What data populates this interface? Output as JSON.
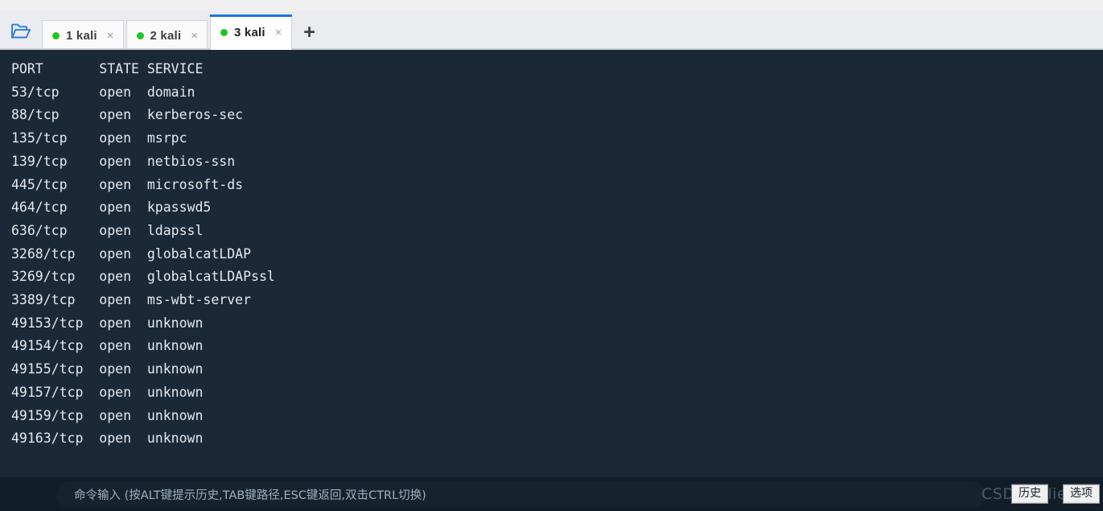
{
  "toolbar": {
    "folder_icon": "open-folder-icon",
    "new_tab_label": "+",
    "tabs": [
      {
        "index": "1",
        "label": "1 kali",
        "status": "connected",
        "close": "×"
      },
      {
        "index": "2",
        "label": "2 kali",
        "status": "connected",
        "close": "×"
      },
      {
        "index": "3",
        "label": "3 kali",
        "status": "connected",
        "close": "×"
      }
    ],
    "active_tab_index": 2
  },
  "terminal": {
    "header": "PORT       STATE SERVICE",
    "lines": [
      "PORT       STATE SERVICE",
      "53/tcp     open  domain",
      "88/tcp     open  kerberos-sec",
      "135/tcp    open  msrpc",
      "139/tcp    open  netbios-ssn",
      "445/tcp    open  microsoft-ds",
      "464/tcp    open  kpasswd5",
      "636/tcp    open  ldapssl",
      "3268/tcp   open  globalcatLDAP",
      "3269/tcp   open  globalcatLDAPssl",
      "3389/tcp   open  ms-wbt-server",
      "49153/tcp  open  unknown",
      "49154/tcp  open  unknown",
      "49155/tcp  open  unknown",
      "49157/tcp  open  unknown",
      "49159/tcp  open  unknown",
      "49163/tcp  open  unknown"
    ],
    "rows": [
      {
        "port": "53/tcp",
        "state": "open",
        "service": "domain"
      },
      {
        "port": "88/tcp",
        "state": "open",
        "service": "kerberos-sec"
      },
      {
        "port": "135/tcp",
        "state": "open",
        "service": "msrpc"
      },
      {
        "port": "139/tcp",
        "state": "open",
        "service": "netbios-ssn"
      },
      {
        "port": "445/tcp",
        "state": "open",
        "service": "microsoft-ds"
      },
      {
        "port": "464/tcp",
        "state": "open",
        "service": "kpasswd5"
      },
      {
        "port": "636/tcp",
        "state": "open",
        "service": "ldapssl"
      },
      {
        "port": "3268/tcp",
        "state": "open",
        "service": "globalcatLDAP"
      },
      {
        "port": "3269/tcp",
        "state": "open",
        "service": "globalcatLDAPssl"
      },
      {
        "port": "3389/tcp",
        "state": "open",
        "service": "ms-wbt-server"
      },
      {
        "port": "49153/tcp",
        "state": "open",
        "service": "unknown"
      },
      {
        "port": "49154/tcp",
        "state": "open",
        "service": "unknown"
      },
      {
        "port": "49155/tcp",
        "state": "open",
        "service": "unknown"
      },
      {
        "port": "49157/tcp",
        "state": "open",
        "service": "unknown"
      },
      {
        "port": "49159/tcp",
        "state": "open",
        "service": "unknown"
      },
      {
        "port": "49163/tcp",
        "state": "open",
        "service": "unknown"
      }
    ],
    "columns": [
      "PORT",
      "STATE",
      "SERVICE"
    ]
  },
  "bottombar": {
    "command_input_value": "",
    "command_input_placeholder": "命令输入 (按ALT键提示历史,TAB键路径,ESC键返回,双击CTRL切换)",
    "watermark": "CSDN @lien.io",
    "history_button": "历史",
    "options_button": "选项"
  },
  "colors": {
    "terminal_bg": "#1a2838",
    "bottombar_bg": "#111d29",
    "terminal_text": "#e6e9ee",
    "tab_accent": "#1a73e8",
    "status_dot": "#21c521",
    "toolbar_bg": "#eaecf0"
  }
}
